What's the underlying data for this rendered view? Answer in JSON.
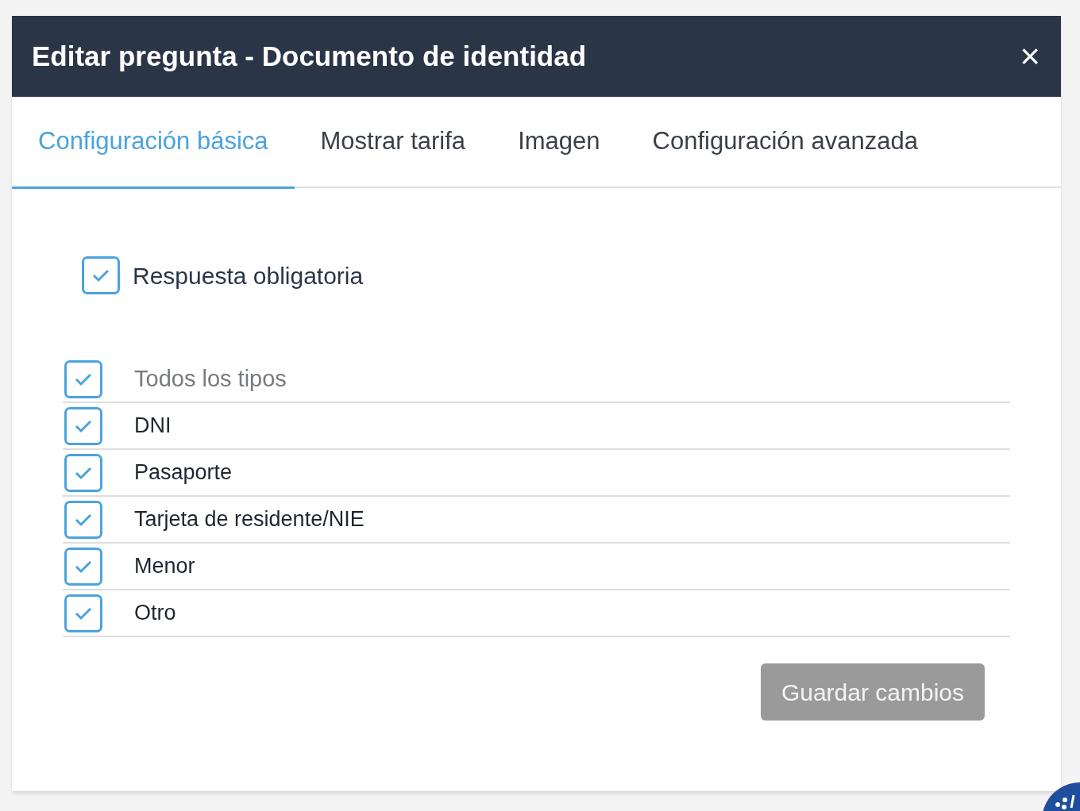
{
  "dialog": {
    "title": "Editar pregunta - Documento de identidad",
    "close": "×"
  },
  "tabs": [
    {
      "label": "Configuración básica",
      "selected": true
    },
    {
      "label": "Mostrar tarifa",
      "selected": false
    },
    {
      "label": "Imagen",
      "selected": false
    },
    {
      "label": "Configuración avanzada",
      "selected": false
    }
  ],
  "required": {
    "label": "Respuesta obligatoria",
    "checked": true
  },
  "document_types": [
    {
      "kind": "all",
      "label": "Todos los tipos",
      "checked": true
    },
    {
      "kind": "option",
      "label": "DNI",
      "checked": true
    },
    {
      "kind": "option",
      "label": "Pasaporte",
      "checked": true
    },
    {
      "kind": "option",
      "label": "Tarjeta de residente/NIE",
      "checked": true
    },
    {
      "kind": "option",
      "label": "Menor",
      "checked": true
    },
    {
      "kind": "option",
      "label": "Otro",
      "checked": true
    }
  ],
  "save_button": {
    "label": "Guardar cambios",
    "disabled": true
  }
}
